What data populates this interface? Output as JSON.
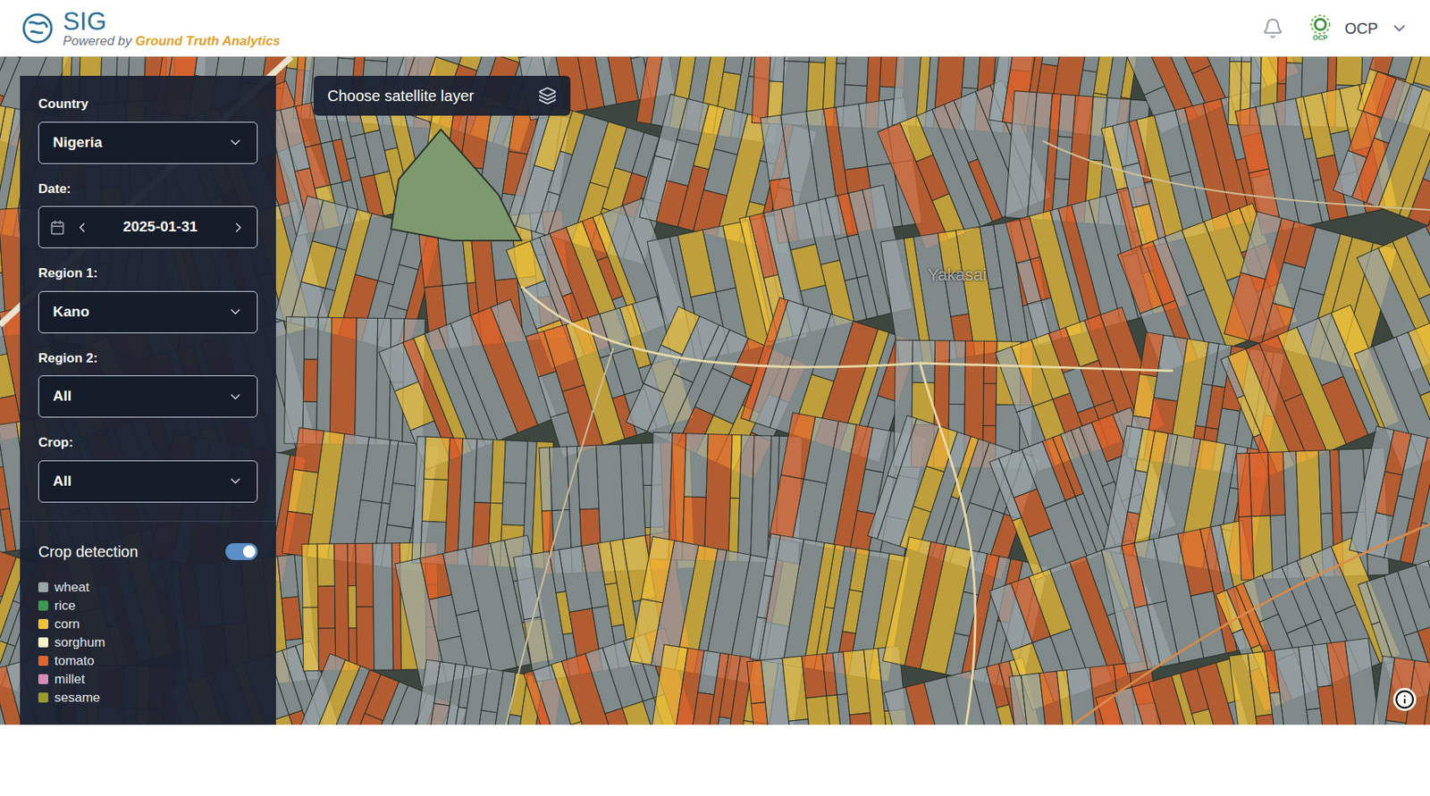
{
  "header": {
    "app_name": "SIG",
    "powered_by": "Powered by",
    "brand": "Ground Truth Analytics",
    "org_logo_text": "OCP",
    "user_menu": "OCP"
  },
  "filters": {
    "country": {
      "label": "Country",
      "value": "Nigeria"
    },
    "date": {
      "label": "Date:",
      "value": "2025-01-31"
    },
    "region1": {
      "label": "Region 1:",
      "value": "Kano"
    },
    "region2": {
      "label": "Region 2:",
      "value": "All"
    },
    "crop": {
      "label": "Crop:",
      "value": "All"
    }
  },
  "crop_detection": {
    "label": "Crop detection",
    "on": true
  },
  "legend": [
    {
      "label": "wheat",
      "color": "#9aa5a8"
    },
    {
      "label": "rice",
      "color": "#3f9a4f"
    },
    {
      "label": "corn",
      "color": "#f0c23a"
    },
    {
      "label": "sorghum",
      "color": "#fbf3c4"
    },
    {
      "label": "tomato",
      "color": "#e0652e"
    },
    {
      "label": "millet",
      "color": "#d88bb5"
    },
    {
      "label": "sesame",
      "color": "#9b9a2e"
    }
  ],
  "layer_button": {
    "label": "Choose satellite layer"
  },
  "map": {
    "place_label": "Yakasai"
  }
}
